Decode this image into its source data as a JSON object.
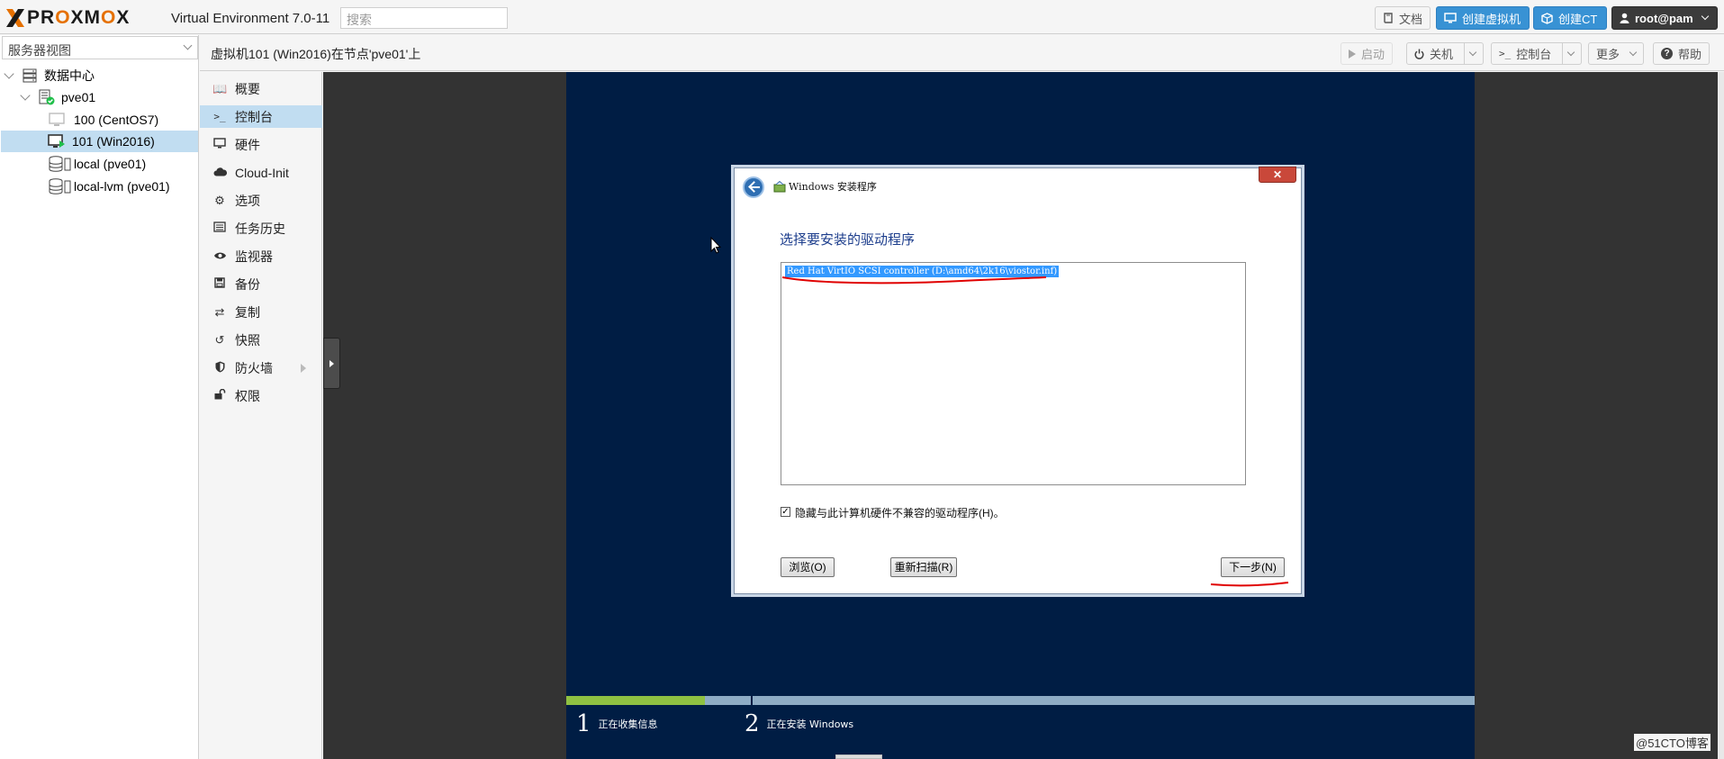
{
  "topbar": {
    "logo": "PROXMOX",
    "version": "Virtual Environment 7.0-11",
    "search_placeholder": "搜索",
    "docs": "文档",
    "create_vm": "创建虚拟机",
    "create_ct": "创建CT",
    "user": "root@pam"
  },
  "tree": {
    "view_selector": "服务器视图",
    "nodes": [
      {
        "label": "数据中心",
        "icon": "datacenter-icon"
      },
      {
        "label": "pve01",
        "icon": "node-online-icon"
      },
      {
        "label": "100 (CentOS7)",
        "icon": "vm-stopped-icon"
      },
      {
        "label": "101 (Win2016)",
        "icon": "vm-running-icon",
        "selected": true
      },
      {
        "label": "local (pve01)",
        "icon": "storage-icon"
      },
      {
        "label": "local-lvm (pve01)",
        "icon": "storage-icon"
      }
    ]
  },
  "breadcrumb": {
    "title": "虚拟机101 (Win2016)在节点'pve01'上",
    "start": "启动",
    "shutdown": "关机",
    "console": "控制台",
    "more": "更多",
    "help": "帮助"
  },
  "menu": [
    {
      "label": "概要",
      "icon": "book-icon"
    },
    {
      "label": "控制台",
      "icon": "terminal-icon",
      "selected": true
    },
    {
      "label": "硬件",
      "icon": "desktop-icon"
    },
    {
      "label": "Cloud-Init",
      "icon": "cloud-icon"
    },
    {
      "label": "选项",
      "icon": "gear-icon"
    },
    {
      "label": "任务历史",
      "icon": "list-icon"
    },
    {
      "label": "监视器",
      "icon": "eye-icon"
    },
    {
      "label": "备份",
      "icon": "floppy-icon"
    },
    {
      "label": "复制",
      "icon": "retweet-icon"
    },
    {
      "label": "快照",
      "icon": "history-icon"
    },
    {
      "label": "防火墙",
      "icon": "shield-icon",
      "has_submenu": true
    },
    {
      "label": "权限",
      "icon": "unlock-icon"
    }
  ],
  "installer": {
    "window_title": "Windows 安装程序",
    "heading": "选择要安装的驱动程序",
    "driver_item": "Red Hat VirtIO SCSI controller (D:\\amd64\\2k16\\viostor.inf)",
    "hide_checkbox_label": "隐藏与此计算机硬件不兼容的驱动程序(H)。",
    "hide_checked": true,
    "browse": "浏览(O)",
    "rescan": "重新扫描(R)",
    "next": "下一步(N)",
    "steps": [
      {
        "num": "1",
        "label": "正在收集信息"
      },
      {
        "num": "2",
        "label": "正在安装 Windows"
      }
    ],
    "progress_fraction": 0.75
  },
  "watermark": "@51CTO博客",
  "colors": {
    "accent_blue": "#3892d4",
    "selection": "#c1ddf1",
    "win_bg": "#001d44",
    "progress_green": "#8fc142",
    "annotation_red": "#e00000"
  }
}
